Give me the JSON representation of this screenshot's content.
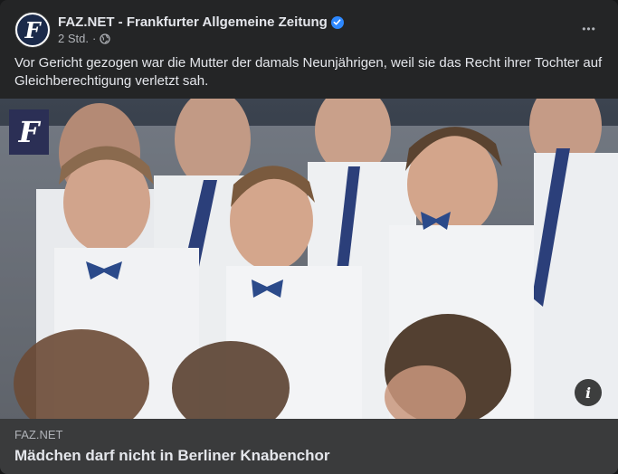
{
  "post": {
    "page_name": "FAZ.NET - Frankfurter Allgemeine Zeitung",
    "avatar_letter": "F",
    "time": "2 Std.",
    "time_sep": "·",
    "more_label": "•••",
    "verified_icon": "verified-check-icon",
    "privacy_icon": "globe-icon",
    "text": "Vor Gericht gezogen war die Mutter der damals Neunjährigen, weil sie das Recht ihrer Tochter auf Gleichberechtigung verletzt sah."
  },
  "media": {
    "logo_letter": "F",
    "info_label": "i"
  },
  "link": {
    "domain": "FAZ.NET",
    "title": "Mädchen darf nicht in Berliner Knabenchor"
  },
  "colors": {
    "card_bg": "#242526",
    "link_bg": "#3a3b3c",
    "verified": "#2d88ff",
    "text_primary": "#e4e6eb",
    "text_secondary": "#b0b3b8"
  }
}
